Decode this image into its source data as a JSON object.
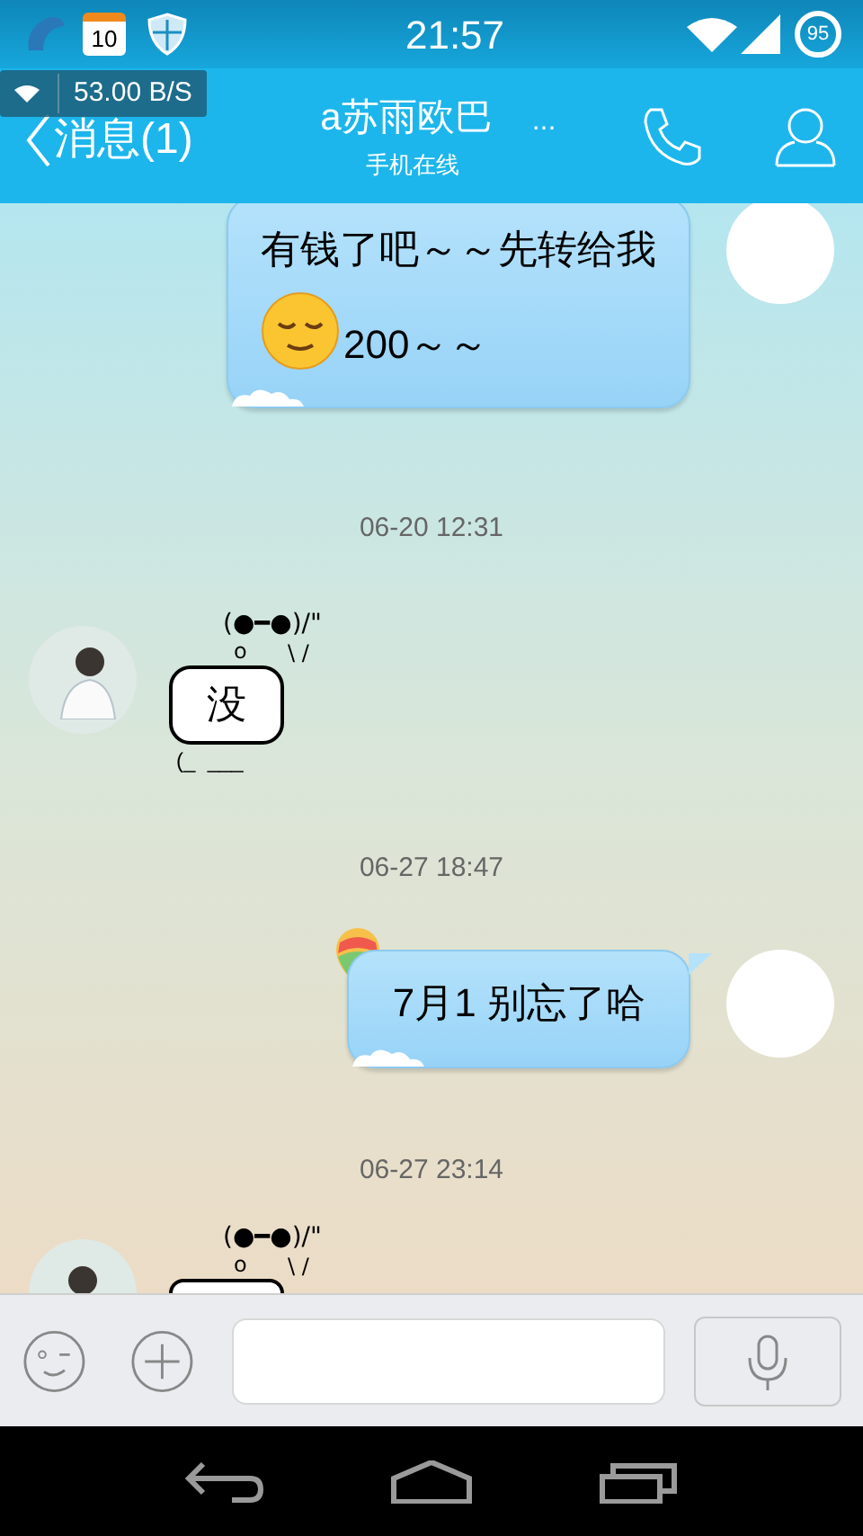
{
  "status_bar": {
    "calendar_day": "10",
    "time": "21:57",
    "battery": "95"
  },
  "net_speed": "53.00 B/S",
  "header": {
    "back_label": "消息(1)",
    "contact_name": "a苏雨欧巴",
    "more": "...",
    "presence": "手机在线"
  },
  "messages": [
    {
      "kind": "bubble",
      "mine": true,
      "text": "有钱了吧～～先转给我",
      "trailer": "200～～"
    },
    {
      "kind": "time",
      "text": "06-20 12:31"
    },
    {
      "kind": "kaomoji",
      "mine": false,
      "face": "(●━●)/\"",
      "mouth": "o",
      "arm": "\\ /",
      "text": "没",
      "base": "(_  ___"
    },
    {
      "kind": "time",
      "text": "06-27 18:47"
    },
    {
      "kind": "bubble",
      "mine": true,
      "text": "7月1  别忘了哈",
      "balloon": true
    },
    {
      "kind": "time",
      "text": "06-27 23:14"
    },
    {
      "kind": "kaomoji",
      "mine": false,
      "face": "(●━●)/\"",
      "mouth": "o",
      "arm": "\\ /"
    }
  ]
}
